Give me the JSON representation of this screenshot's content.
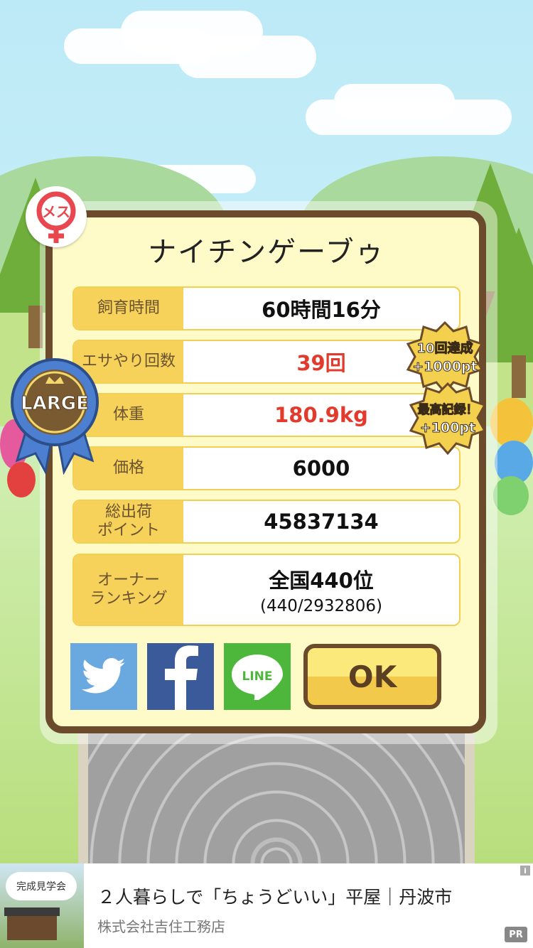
{
  "popup": {
    "title": "ナイチンゲーブゥ",
    "gender_label": "メス",
    "size_badge": "LARGE",
    "rows": [
      {
        "label": "飼育時間",
        "value": "60時間16分"
      },
      {
        "label": "エサやり回数",
        "value": "39回"
      },
      {
        "label": "体重",
        "value": "180.9kg"
      },
      {
        "label": "価格",
        "value": "6000"
      },
      {
        "label": "総出荷\nポイント",
        "value": "45837134"
      },
      {
        "label": "オーナー\nランキング",
        "value": "全国440位",
        "sub": "(440/2932806)"
      }
    ],
    "badges": [
      {
        "line1": "10回達成",
        "line2": "+1000pt"
      },
      {
        "line1": "最高記録！",
        "line2": "+100pt"
      }
    ],
    "share": {
      "line_label": "LINE"
    },
    "ok_label": "OK"
  },
  "ad": {
    "title": "２人暮らしで「ちょうどいい」平屋｜丹波市",
    "advertiser": "株式会社吉住工務店",
    "thumb_text": "完成見学会",
    "pr_label": "PR",
    "info_label": "i"
  },
  "colors": {
    "accent": "#f6d25a",
    "border": "#6b4b2c",
    "red_value": "#e23b2e"
  }
}
